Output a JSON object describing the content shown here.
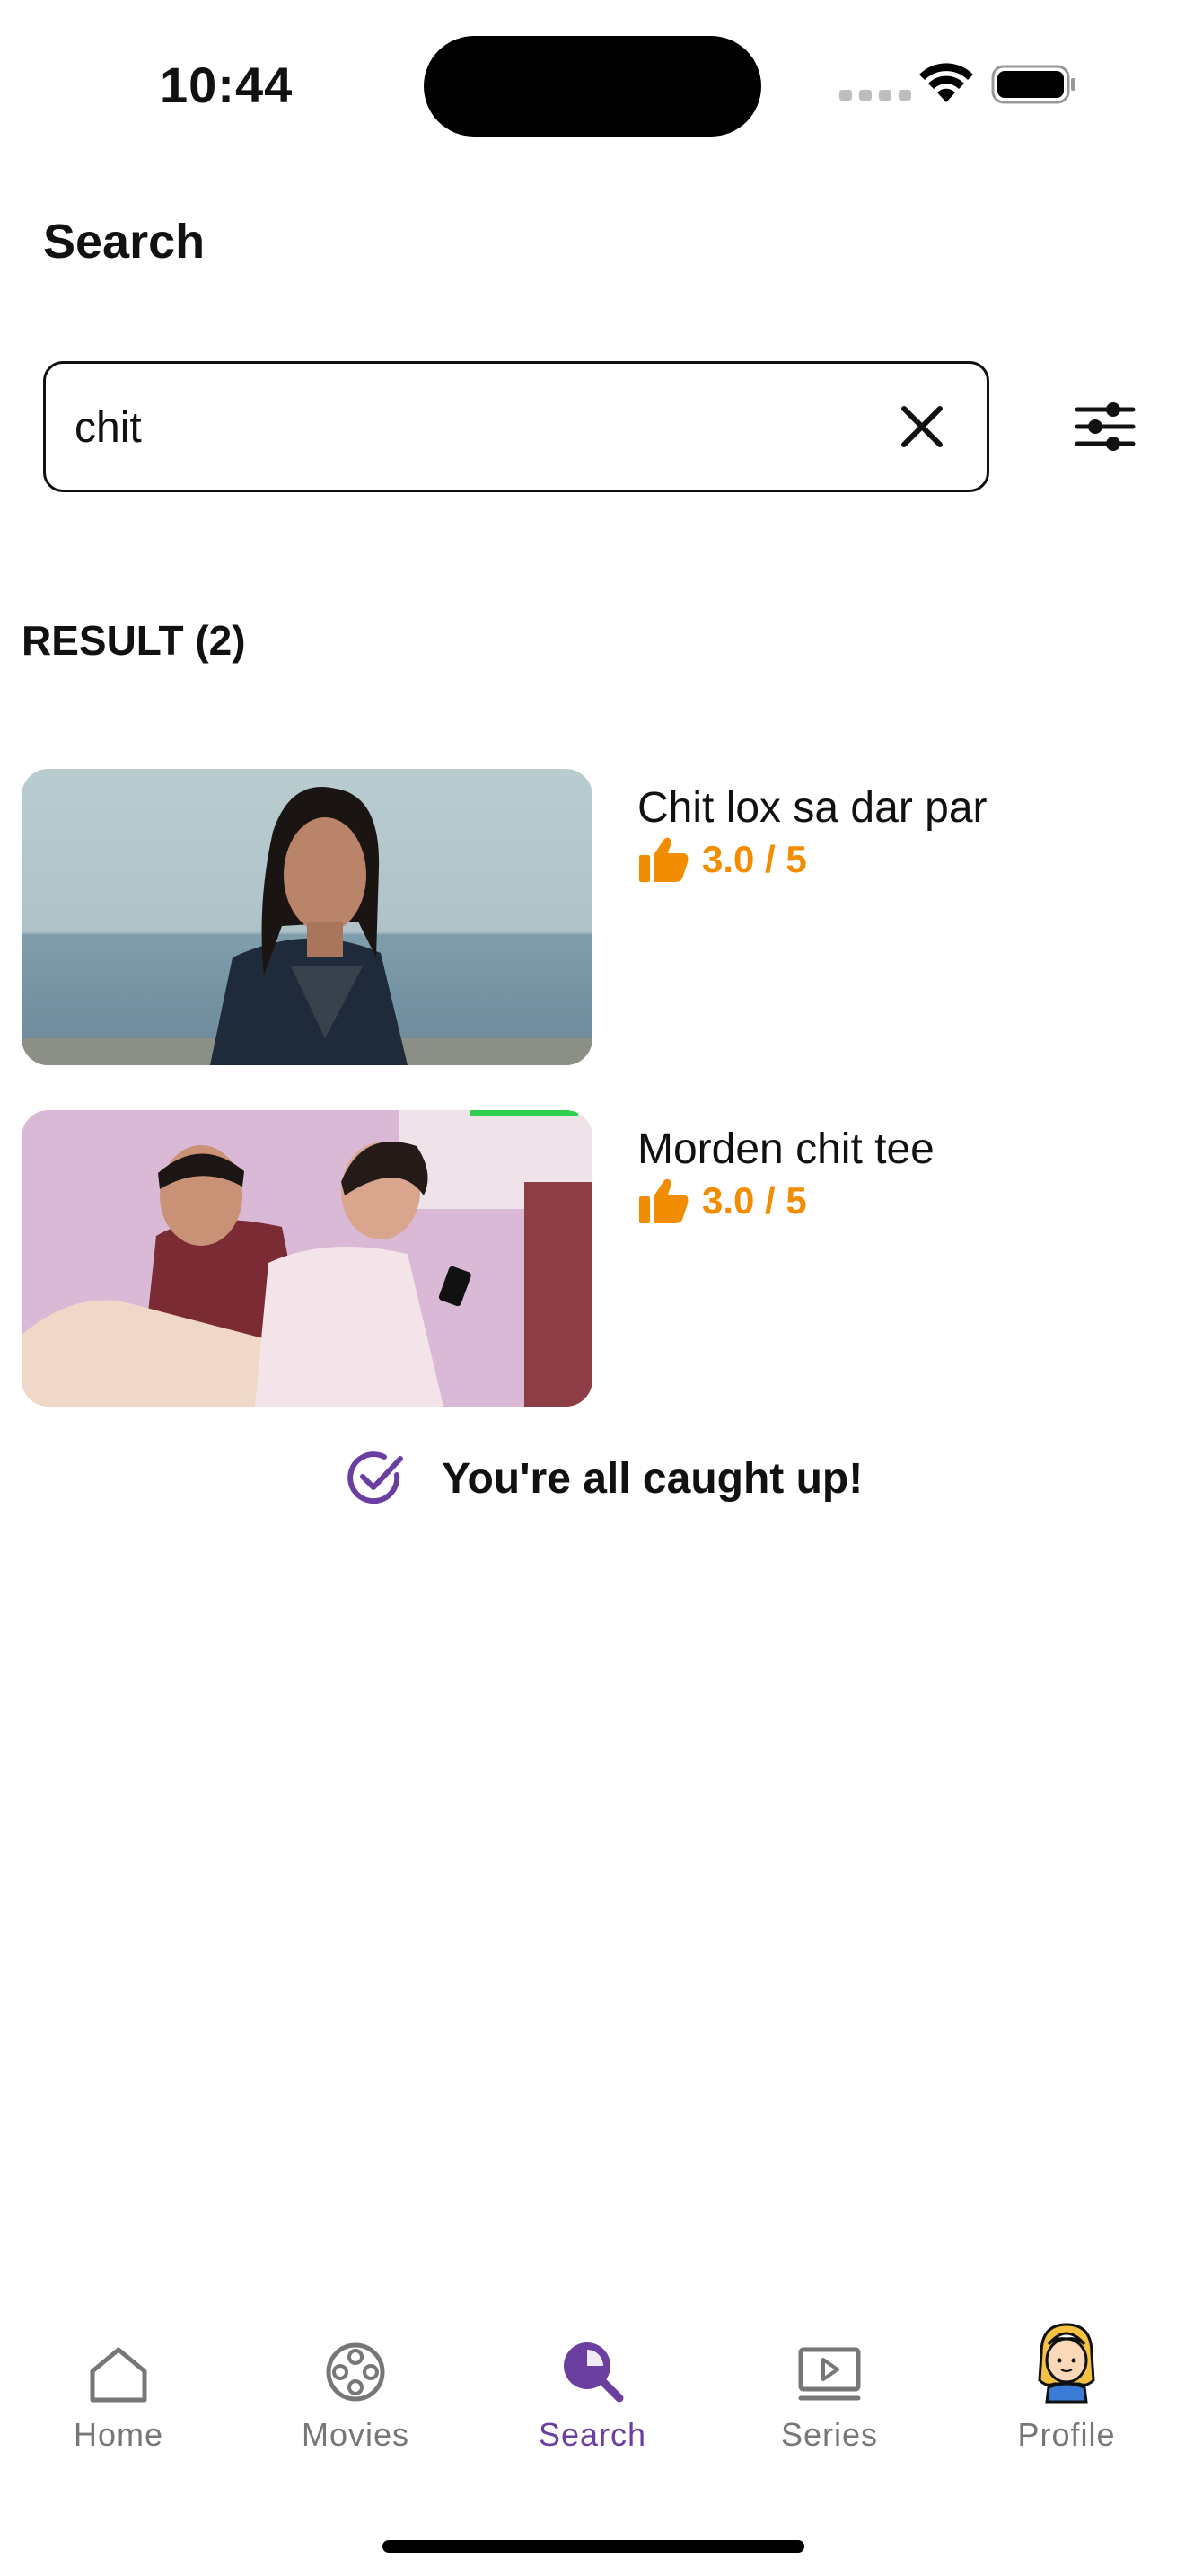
{
  "status_bar": {
    "time": "10:44"
  },
  "header": {
    "title": "Search"
  },
  "search": {
    "value": "chit",
    "placeholder": ""
  },
  "results": {
    "heading": "RESULT (2)",
    "items": [
      {
        "title": "Chit lox sa dar par",
        "rating": "3.0 / 5"
      },
      {
        "title": "Morden chit tee",
        "rating": "3.0 / 5"
      }
    ]
  },
  "footer_message": "You're all caught up!",
  "nav": {
    "items": [
      {
        "label": "Home",
        "icon": "home-icon"
      },
      {
        "label": "Movies",
        "icon": "film-reel-icon"
      },
      {
        "label": "Search",
        "icon": "search-icon"
      },
      {
        "label": "Series",
        "icon": "play-screen-icon"
      },
      {
        "label": "Profile",
        "icon": "avatar-icon"
      }
    ],
    "active": "Search"
  },
  "colors": {
    "accent": "#6b3fa0",
    "rating": "#f28c00",
    "text": "#111111",
    "muted": "#777777"
  }
}
